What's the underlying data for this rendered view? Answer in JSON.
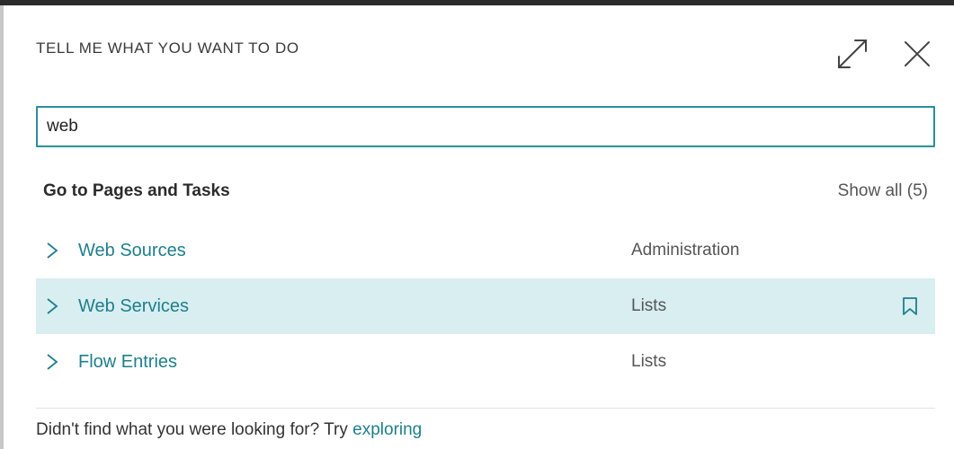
{
  "dialog": {
    "title": "TELL ME WHAT YOU WANT TO DO",
    "expand_icon": "expand-icon",
    "close_icon": "close-icon"
  },
  "search": {
    "value": "web",
    "placeholder": ""
  },
  "section": {
    "title": "Go to Pages and Tasks",
    "show_all": "Show all (5)"
  },
  "results": [
    {
      "name": "Web Sources",
      "category": "Administration",
      "selected": false
    },
    {
      "name": "Web Services",
      "category": "Lists",
      "selected": true
    },
    {
      "name": "Flow Entries",
      "category": "Lists",
      "selected": false
    }
  ],
  "footer": {
    "text": "Didn't find what you were looking for? Try ",
    "link": "exploring"
  },
  "colors": {
    "accent": "#1e7f8c",
    "search_border": "#2a8f9c",
    "selected_row": "#d8eef0"
  }
}
